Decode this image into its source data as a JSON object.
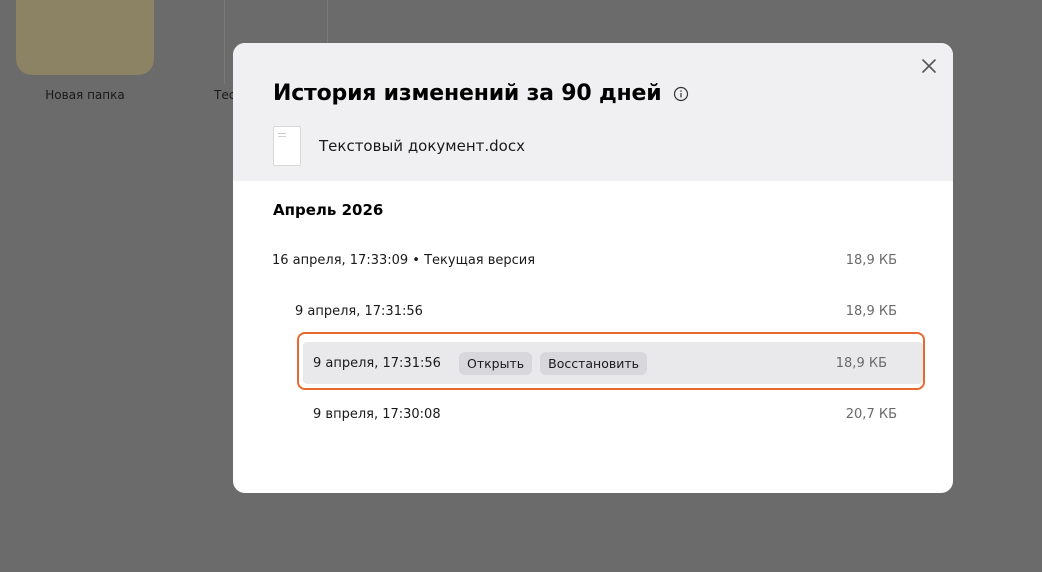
{
  "background": {
    "folder_name": "Новая папка",
    "doc_name": "Тес"
  },
  "modal": {
    "title": "История изменений за 90 дней",
    "file_name": "Текстовый документ.docx",
    "month": "Апрель 2026",
    "versions": [
      {
        "time": "16 апреля, 17:33:09 • Текущая версия",
        "size": "18,9 КБ"
      },
      {
        "time": "9 апреля, 17:31:56",
        "size": "18,9 КБ"
      },
      {
        "time": "9 апреля, 17:31:56",
        "size": "18,9 КБ",
        "open_label": "Открыть",
        "restore_label": "Восстановить"
      },
      {
        "time": "9 впреля, 17:30:08",
        "size": "20,7 КБ"
      }
    ]
  },
  "colors": {
    "highlight": "#e8692e",
    "overlay": "#6b6b6b"
  }
}
